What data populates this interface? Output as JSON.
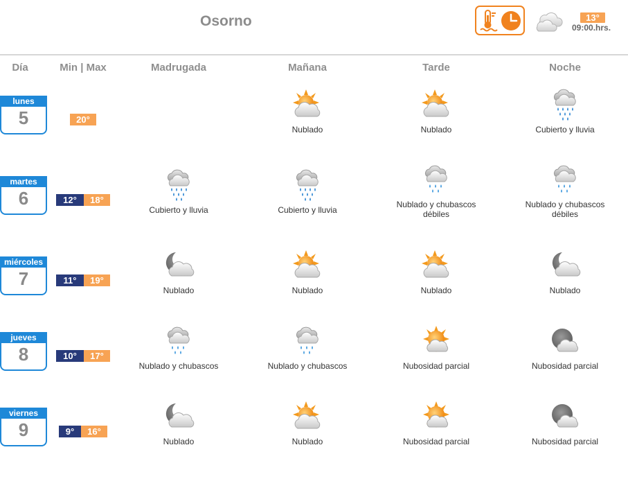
{
  "header": {
    "city": "Osorno",
    "now_temp": "13°",
    "now_time": "09:00.hrs.",
    "now_icon": "cloudy-icon",
    "mode_button_icons": [
      "thermometer-icon",
      "clock-icon"
    ]
  },
  "columns": {
    "day": "Día",
    "minmax": "Min | Max",
    "madrugada": "Madrugada",
    "manana": "Mañana",
    "tarde": "Tarde",
    "noche": "Noche"
  },
  "days": [
    {
      "name": "lunes",
      "number": "5",
      "min": "",
      "max": "20°",
      "periods": [
        null,
        {
          "icon": "sun-cloud",
          "desc": "Nublado"
        },
        {
          "icon": "sun-cloud",
          "desc": "Nublado"
        },
        {
          "icon": "heavy-rain",
          "desc": "Cubierto y lluvia"
        }
      ]
    },
    {
      "name": "martes",
      "number": "6",
      "min": "12°",
      "max": "18°",
      "periods": [
        {
          "icon": "heavy-rain",
          "desc": "Cubierto y lluvia"
        },
        {
          "icon": "heavy-rain",
          "desc": "Cubierto y lluvia"
        },
        {
          "icon": "showers",
          "desc": "Nublado y chubascos débiles"
        },
        {
          "icon": "showers",
          "desc": "Nublado y chubascos débiles"
        }
      ]
    },
    {
      "name": "miércoles",
      "number": "7",
      "min": "11°",
      "max": "19°",
      "periods": [
        {
          "icon": "moon-cloud",
          "desc": "Nublado"
        },
        {
          "icon": "sun-cloud",
          "desc": "Nublado"
        },
        {
          "icon": "sun-cloud",
          "desc": "Nublado"
        },
        {
          "icon": "moon-cloud",
          "desc": "Nublado"
        }
      ]
    },
    {
      "name": "jueves",
      "number": "8",
      "min": "10°",
      "max": "17°",
      "periods": [
        {
          "icon": "showers",
          "desc": "Nublado y chubascos"
        },
        {
          "icon": "showers",
          "desc": "Nublado y chubascos"
        },
        {
          "icon": "sun-partial",
          "desc": "Nubosidad parcial"
        },
        {
          "icon": "moon-partial",
          "desc": "Nubosidad parcial"
        }
      ]
    },
    {
      "name": "viernes",
      "number": "9",
      "min": "9°",
      "max": "16°",
      "periods": [
        {
          "icon": "moon-cloud",
          "desc": "Nublado"
        },
        {
          "icon": "sun-cloud",
          "desc": "Nublado"
        },
        {
          "icon": "sun-partial",
          "desc": "Nubosidad parcial"
        },
        {
          "icon": "moon-partial",
          "desc": "Nubosidad parcial"
        }
      ]
    }
  ],
  "colors": {
    "accent_orange": "#f0821e",
    "max_badge": "#f7a354",
    "min_badge": "#283a7a",
    "calendar_blue": "#1e88d8"
  }
}
